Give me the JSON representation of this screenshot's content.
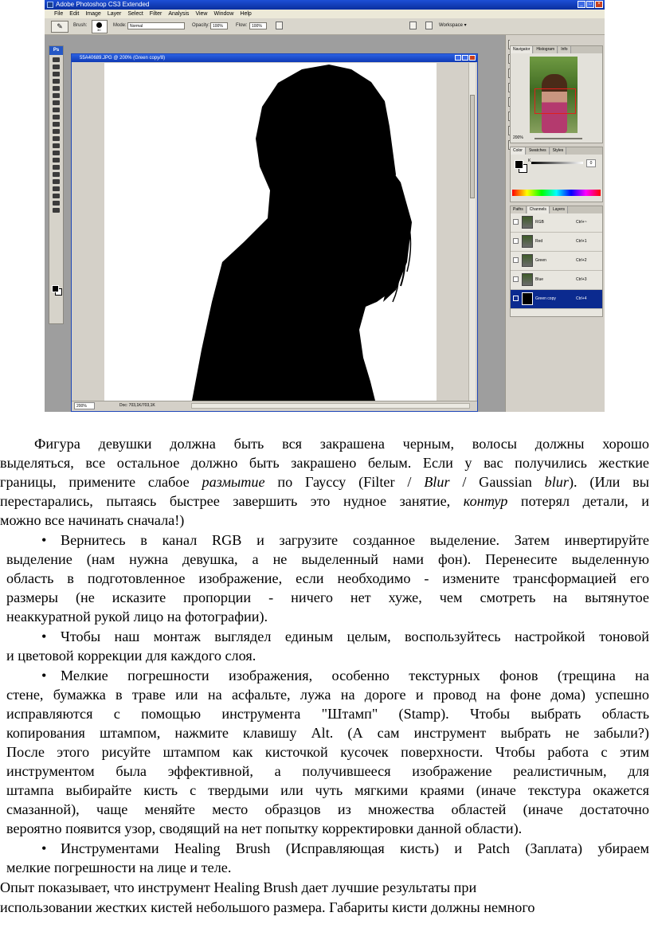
{
  "photoshop": {
    "app_title": "Adobe Photoshop CS3 Extended",
    "menu": [
      "File",
      "Edit",
      "Image",
      "Layer",
      "Select",
      "Filter",
      "Analysis",
      "View",
      "Window",
      "Help"
    ],
    "options": {
      "brush_label": "Brush:",
      "brush_size": "30",
      "mode_label": "Mode:",
      "mode_value": "Normal",
      "opacity_label": "Opacity:",
      "opacity_value": "100%",
      "flow_label": "Flow:",
      "flow_value": "100%",
      "workspace_label": "Workspace ▾"
    },
    "toolbox_logo": "Ps",
    "document": {
      "title": "55A40689.JPG @ 200% (Green copy/8)",
      "zoom": "200%",
      "doc_info": "Doc: 703,1K/703,1K"
    },
    "panels": {
      "navigator_tabs": [
        "Navigator",
        "Histogram",
        "Info"
      ],
      "navigator_zoom": "200%",
      "color_tabs": [
        "Color",
        "Swatches",
        "Styles"
      ],
      "color_channel": "K",
      "color_value": "0",
      "channels_tabs": [
        "Paths",
        "Channels",
        "Layers"
      ],
      "channels": [
        {
          "name": "RGB",
          "shortcut": "Ctrl+~"
        },
        {
          "name": "Red",
          "shortcut": "Ctrl+1"
        },
        {
          "name": "Green",
          "shortcut": "Ctrl+2"
        },
        {
          "name": "Blue",
          "shortcut": "Ctrl+3"
        },
        {
          "name": "Green copy",
          "shortcut": "Ctrl+4"
        }
      ]
    }
  },
  "text": {
    "para1": {
      "l1": "Фигура девушки должна быть вся закрашена черным, волосы должны хорошо",
      "l2": "выделяться, все остальное должно быть закрашено белым. Если у вас получились жесткие",
      "l3_a": "границы, примените слабое ",
      "l3_b": "размытие",
      "l3_c": " по Гауссу (Filter / ",
      "l3_d": "Blur",
      "l3_e": " / Gaussian ",
      "l3_f": "blur",
      "l3_g": "). (Или вы",
      "l4_a": "перестарались, пытаясь быстрее завершить это нудное занятие, ",
      "l4_b": "контур",
      "l4_c": " потерял детали, и",
      "l5": "можно все начинать сначала!)"
    },
    "bullet1": {
      "l1": "Вернитесь в канал RGB и загрузите созданное выделение. Затем инвертируйте",
      "l2": "выделение (нам нужна девушка, а не выделенный нами фон). Перенесите выделенную",
      "l3": "область в подготовленное изображение, если необходимо - измените трансформацией его",
      "l4": "размеры (не исказите пропорции - ничего нет хуже, чем смотреть на вытянутое",
      "l5": "неаккуратной рукой лицо на фотографии)."
    },
    "bullet2": {
      "l1": "Чтобы наш монтаж выглядел единым целым, воспользуйтесь настройкой тоновой",
      "l2": "и цветовой коррекции для каждого слоя."
    },
    "bullet3": {
      "l1": "Мелкие погрешности изображения, особенно текстурных фонов (трещина на",
      "l2": "стене, бумажка в траве или на асфальте, лужа на дороге и провод на фоне дома) успешно",
      "l3": "исправляются с помощью инструмента \"Штамп\" (Stamp). Чтобы выбрать область",
      "l4": "копирования штампом, нажмите клавишу Alt. (А сам инструмент выбрать не забыли?)",
      "l5": "После этого рисуйте штампом как кисточкой кусочек поверхности. Чтобы работа с этим",
      "l6": "инструментом была эффективной, а получившееся изображение реалистичным, для",
      "l7": "штампа выбирайте кисть с твердыми или чуть мягкими краями (иначе текстура окажется",
      "l8": "смазанной), чаще меняйте место образцов из множества областей (иначе достаточно",
      "l9": "вероятно появится узор, сводящий на нет попытку корректировки данной области)."
    },
    "bullet4": {
      "l1": "Инструментами Healing Brush (Исправляющая кисть) и Patch (Заплата) убираем",
      "l2": "мелкие погрешности на лице и теле."
    },
    "para2": {
      "l1": "Опыт показывает, что инструмент Healing Brush дает лучшие результаты при",
      "l2": "использовании жестких кистей небольшого размера. Габариты кисти должны немного"
    },
    "bullet_char": "•"
  }
}
